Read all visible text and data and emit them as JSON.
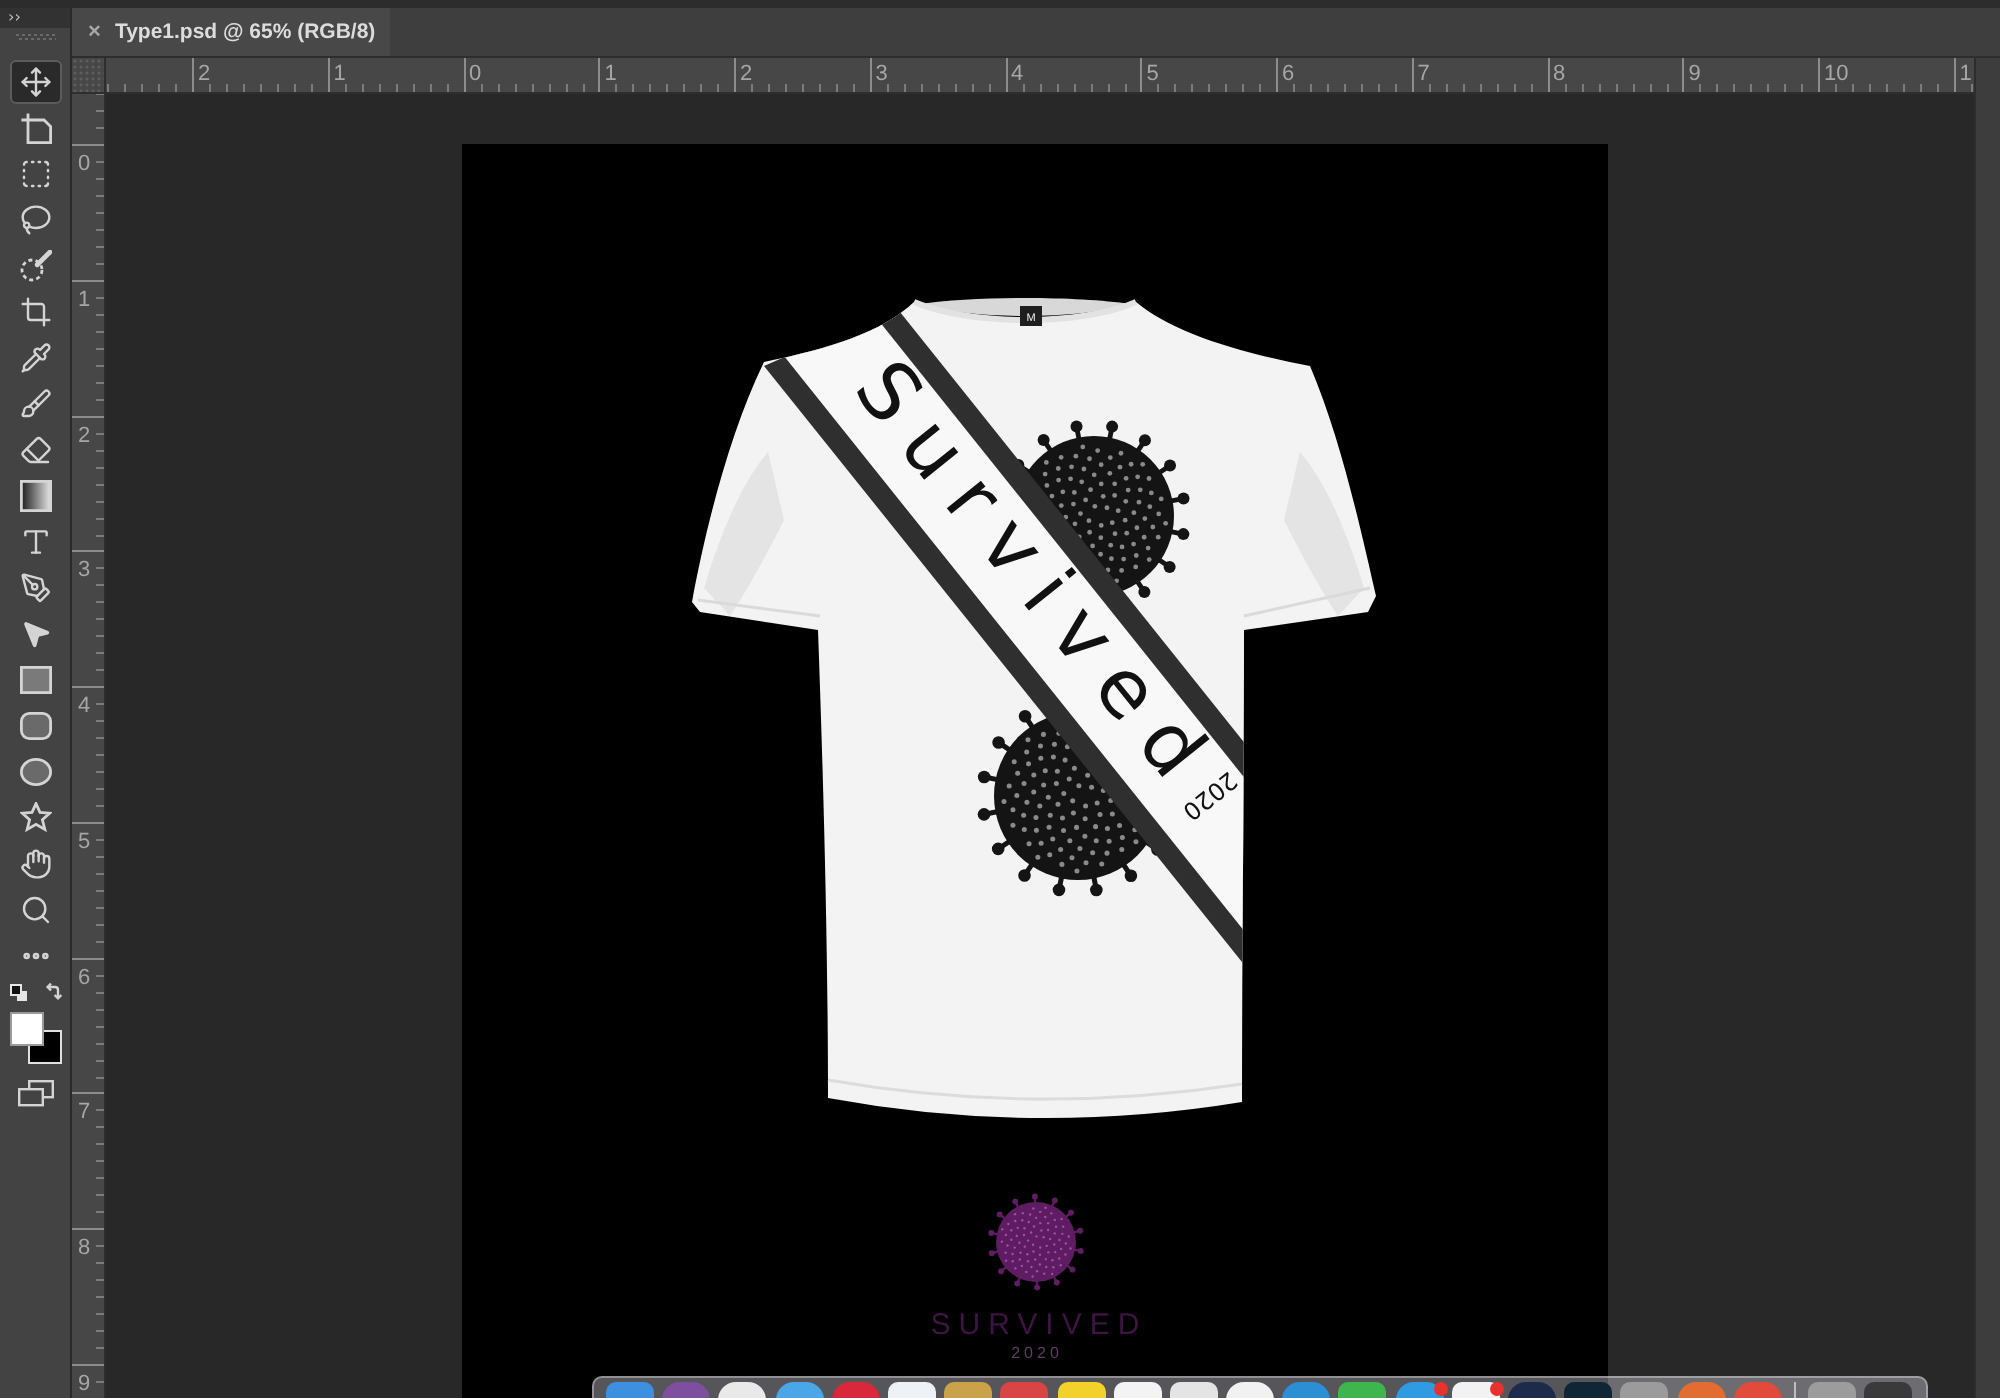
{
  "toolbar": {
    "collapse": "››",
    "tools": [
      {
        "kind": "move",
        "selected": true
      },
      {
        "kind": "artboard",
        "selected": false
      },
      {
        "kind": "marquee",
        "selected": false
      },
      {
        "kind": "lasso",
        "selected": false
      },
      {
        "kind": "quick_select",
        "selected": false
      },
      {
        "kind": "crop",
        "selected": false
      },
      {
        "kind": "eyedropper",
        "selected": false
      },
      {
        "kind": "brush",
        "selected": false
      },
      {
        "kind": "eraser",
        "selected": false
      },
      {
        "kind": "gradient",
        "selected": false
      },
      {
        "kind": "type",
        "selected": false
      },
      {
        "kind": "pen",
        "selected": false
      },
      {
        "kind": "path_select",
        "selected": false
      },
      {
        "kind": "rectangle",
        "selected": false
      },
      {
        "kind": "rounded_rectangle",
        "selected": false
      },
      {
        "kind": "ellipse",
        "selected": false
      },
      {
        "kind": "custom_shape",
        "selected": false
      },
      {
        "kind": "hand",
        "selected": false
      },
      {
        "kind": "zoom",
        "selected": false
      },
      {
        "kind": "more",
        "selected": false
      }
    ]
  },
  "document_tab": {
    "close": "×",
    "title": "Type1.psd @ 65% (RGB/8)"
  },
  "rulers": {
    "horizontal": [
      "2",
      "1",
      "0",
      "1",
      "2",
      "3",
      "4",
      "5",
      "6",
      "7",
      "8",
      "9",
      "10",
      "1"
    ],
    "vertical": [
      "0",
      "1",
      "2",
      "3",
      "4",
      "5",
      "6",
      "7",
      "8",
      "9"
    ]
  },
  "artwork": {
    "shirt": {
      "size_tag": "M",
      "sash_text": "Survived",
      "sash_year": "2020"
    },
    "logo": {
      "title": "SURVIVED",
      "year": "2020"
    }
  },
  "dock": {
    "apps": [
      {
        "kind": "square",
        "color": "#3d8fe0",
        "badge": false
      },
      {
        "kind": "round",
        "color": "#7d4f9e",
        "badge": false
      },
      {
        "kind": "round",
        "color": "#e9e9e9",
        "badge": false
      },
      {
        "kind": "round",
        "color": "#4aa6e6",
        "badge": false
      },
      {
        "kind": "round",
        "color": "#d9283c",
        "badge": false
      },
      {
        "kind": "square",
        "color": "#eef2f7",
        "badge": false
      },
      {
        "kind": "square",
        "color": "#c9a24a",
        "badge": false
      },
      {
        "kind": "square",
        "color": "#d94444",
        "badge": false
      },
      {
        "kind": "square",
        "color": "#f2d12a",
        "badge": false
      },
      {
        "kind": "square",
        "color": "#f3f3f3",
        "badge": false
      },
      {
        "kind": "square",
        "color": "#e4e4e4",
        "badge": false
      },
      {
        "kind": "round",
        "color": "#f1f1f1",
        "badge": false
      },
      {
        "kind": "round",
        "color": "#2c8fd4",
        "badge": false
      },
      {
        "kind": "square",
        "color": "#3fb54d",
        "badge": false
      },
      {
        "kind": "round",
        "color": "#2e9be2",
        "badge": true
      },
      {
        "kind": "square",
        "color": "#f2f2f2",
        "badge": true
      },
      {
        "kind": "round",
        "color": "#1c2b4c",
        "badge": false
      },
      {
        "kind": "square",
        "color": "#0f2636",
        "badge": false
      },
      {
        "kind": "square",
        "color": "#9b9b9b",
        "badge": false
      },
      {
        "kind": "round",
        "color": "#e26c32",
        "badge": false
      },
      {
        "kind": "round",
        "color": "#e24b3b",
        "badge": false
      },
      {
        "kind": "separator"
      },
      {
        "kind": "square",
        "color": "#9c9c9c",
        "badge": false
      },
      {
        "kind": "square",
        "color": "#3a3a3a",
        "badge": false
      }
    ]
  }
}
